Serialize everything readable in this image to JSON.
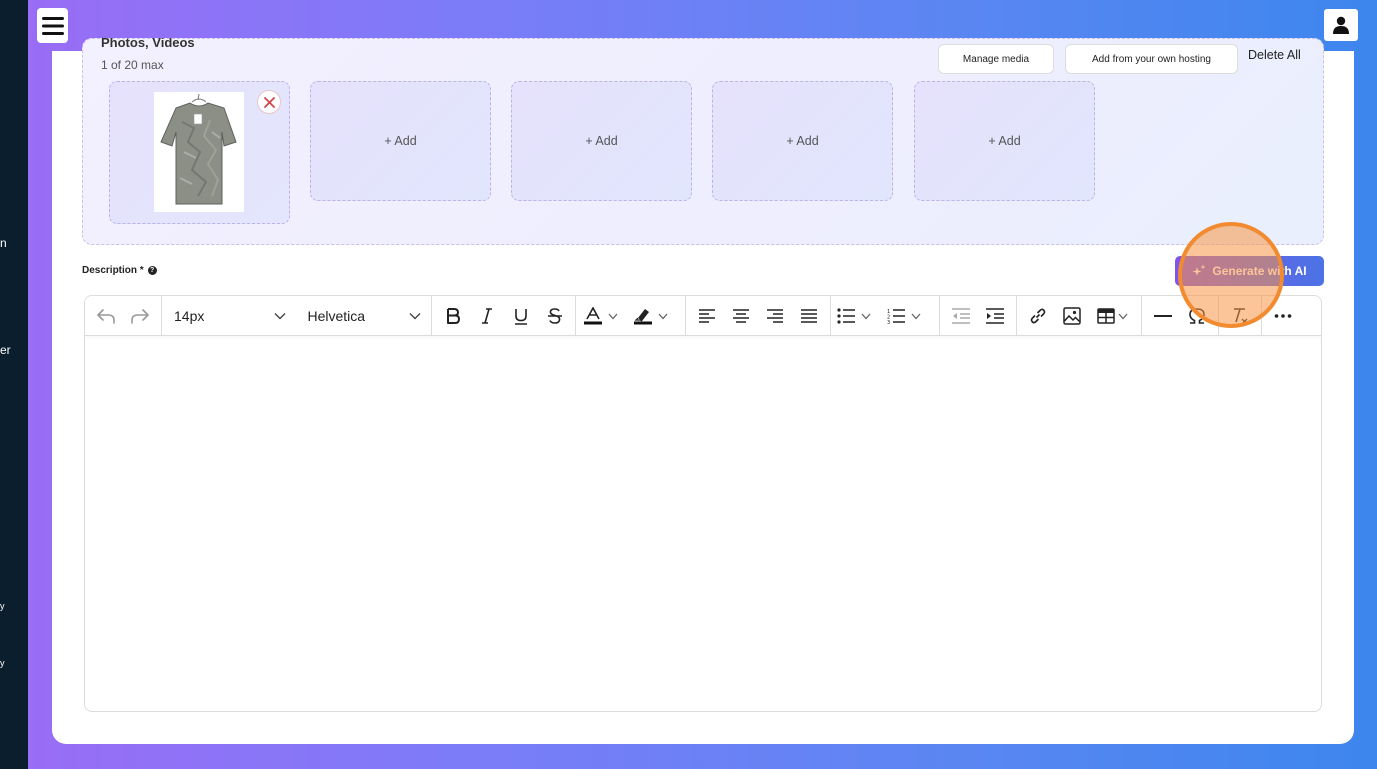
{
  "sidebar": {
    "fragments": [
      "n",
      "er",
      "y",
      "y"
    ]
  },
  "media": {
    "title": "Photos, Videos",
    "count_text": "1 of 20 max",
    "manage_label": "Manage media",
    "hosting_label": "Add from your own hosting",
    "delete_all_label": "Delete All",
    "add_slots": [
      "+ Add",
      "+ Add",
      "+ Add",
      "+ Add"
    ]
  },
  "description": {
    "label": "Description *",
    "help": "?",
    "generate_label": "Generate with AI"
  },
  "toolbar": {
    "font_size": "14px",
    "font_family": "Helvetica"
  },
  "colors": {
    "accent": "#7c56e8",
    "highlight": "#f28a30"
  }
}
